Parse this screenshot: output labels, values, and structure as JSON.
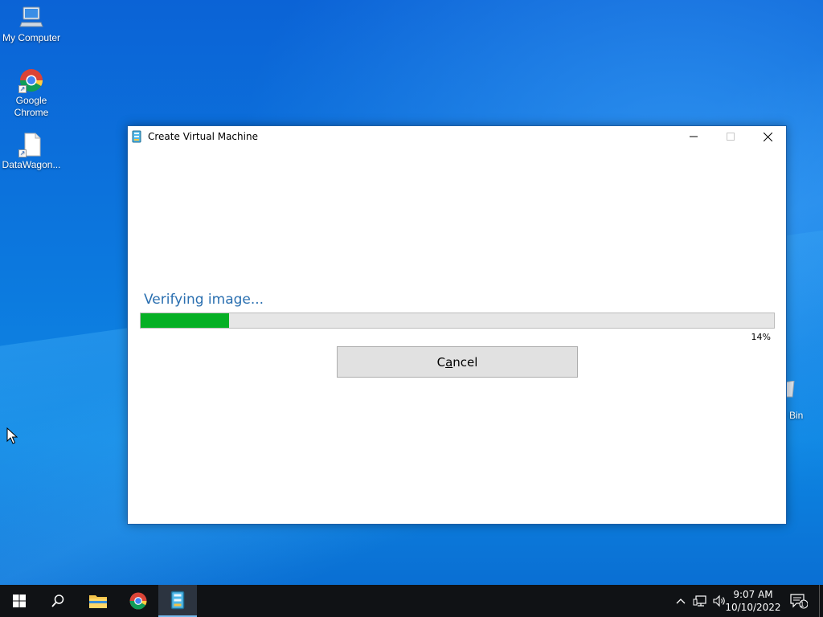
{
  "desktop": {
    "icons": [
      {
        "label": "My Computer",
        "icon": "computer-icon"
      },
      {
        "label": "Google Chrome",
        "icon": "chrome-icon"
      },
      {
        "label": "DataWagon...",
        "icon": "file-icon"
      }
    ],
    "recycle_bin_label": "e Bin"
  },
  "window": {
    "title": "Create Virtual Machine",
    "status": "Verifying image...",
    "progress_percent": 14,
    "progress_label": "14%",
    "cancel_prefix": "C",
    "cancel_mnemonic": "a",
    "cancel_suffix": "ncel"
  },
  "taskbar": {
    "items": [
      "start-icon",
      "search-icon",
      "file-explorer-icon",
      "chrome-icon",
      "virtual-machine-app-icon"
    ],
    "clock_time": "9:07 AM",
    "clock_date": "10/10/2022",
    "notification_count": "1"
  },
  "colors": {
    "progress_fill": "#06b025",
    "status_text": "#2a6fb0",
    "taskbar": "#101215"
  }
}
